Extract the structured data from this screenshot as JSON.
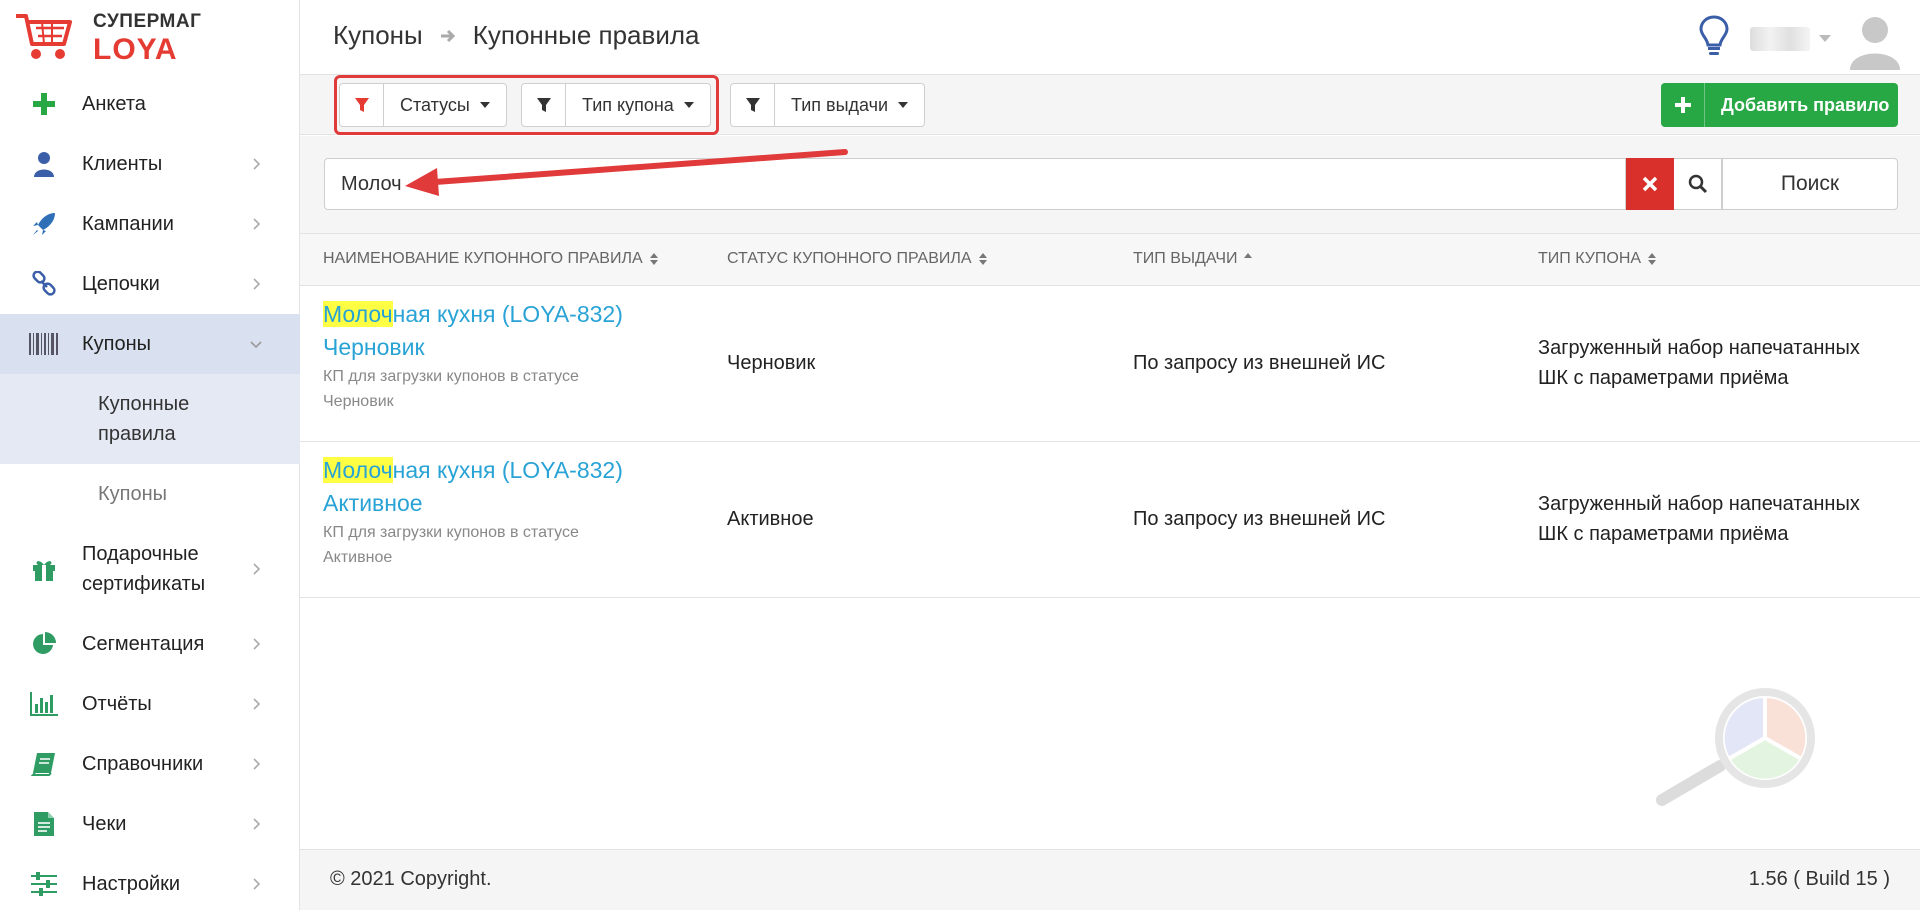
{
  "brand": {
    "top": "СУПЕРМАГ",
    "bottom": "LOYA"
  },
  "breadcrumb": {
    "parent": "Купоны",
    "current": "Купонные правила"
  },
  "sidebar": {
    "items": [
      {
        "label": "Анкета",
        "icon": "plus-icon"
      },
      {
        "label": "Клиенты",
        "icon": "user-icon"
      },
      {
        "label": "Кампании",
        "icon": "rocket-icon"
      },
      {
        "label": "Цепочки",
        "icon": "chain-icon"
      },
      {
        "label": "Купоны",
        "icon": "barcode-icon"
      },
      {
        "label": "Подарочные сертификаты",
        "icon": "gift-icon"
      },
      {
        "label": "Сегментация",
        "icon": "pie-chart-icon"
      },
      {
        "label": "Отчёты",
        "icon": "bar-chart-icon"
      },
      {
        "label": "Справочники",
        "icon": "book-icon"
      },
      {
        "label": "Чеки",
        "icon": "receipt-icon"
      },
      {
        "label": "Настройки",
        "icon": "sliders-icon"
      }
    ],
    "sub_items": [
      {
        "label": "Купонные правила"
      },
      {
        "label": "Купоны"
      }
    ]
  },
  "toolbar": {
    "filters": [
      {
        "label": "Статусы",
        "active": true
      },
      {
        "label": "Тип купона",
        "active": false
      },
      {
        "label": "Тип выдачи",
        "active": false
      }
    ],
    "add_label": "Добавить правило"
  },
  "search": {
    "value": "Молоч",
    "button_label": "Поиск"
  },
  "table": {
    "headers": [
      "НАИМЕНОВАНИЕ КУПОННОГО ПРАВИЛА",
      "СТАТУС КУПОННОГО ПРАВИЛА",
      "ТИП ВЫДАЧИ",
      "ТИП КУПОНА"
    ],
    "rows": [
      {
        "name_highlight": "Молоч",
        "name_rest": "ная кухня (LOYA-832)",
        "name_line2": "Черновик",
        "desc_line1": "КП для загрузки купонов в статусе",
        "desc_line2": "Черновик",
        "status": "Черновик",
        "issue_type": "По запросу из внешней ИС",
        "coupon_type_line1": "Загруженный набор напечатанных",
        "coupon_type_line2": "ШК с параметрами приёма"
      },
      {
        "name_highlight": "Молоч",
        "name_rest": "ная кухня (LOYA-832)",
        "name_line2": "Активное",
        "desc_line1": "КП для загрузки купонов в статусе",
        "desc_line2": "Активное",
        "status": "Активное",
        "issue_type": "По запросу из внешней ИС",
        "coupon_type_line1": "Загруженный набор напечатанных",
        "coupon_type_line2": "ШК с параметрами приёма"
      }
    ]
  },
  "footer": {
    "copyright": "© 2021 Copyright.",
    "version": "1.56 ( Build 15 )"
  },
  "colors": {
    "accent_red": "#e53b33",
    "link": "#29a3d6",
    "green": "#28a745",
    "highlight": "#ffff44"
  }
}
